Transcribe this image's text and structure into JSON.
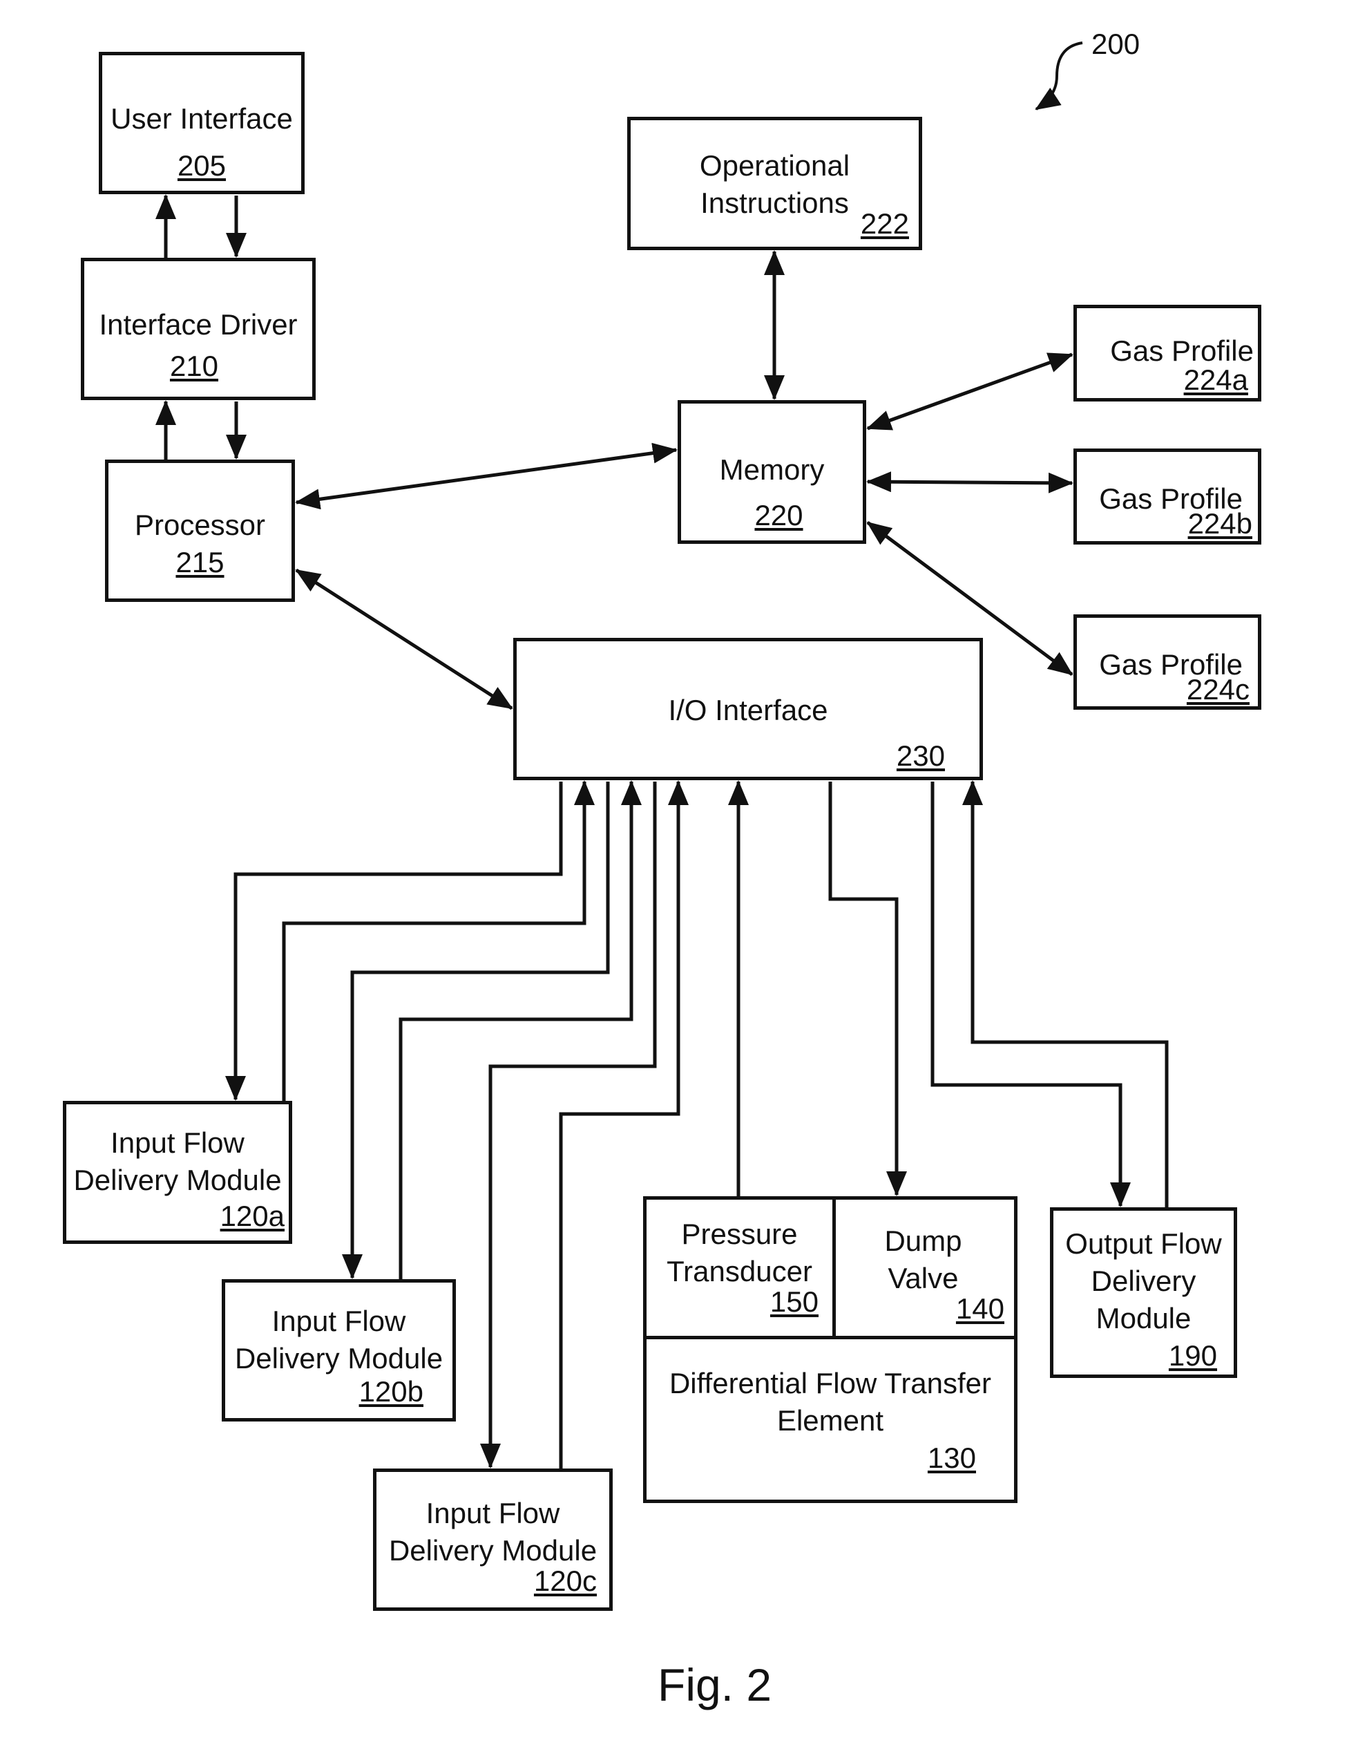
{
  "figure": {
    "label": "Fig. 2",
    "ref": "200"
  },
  "blocks": {
    "user_interface": {
      "name": "User Interface",
      "ref": "205"
    },
    "interface_driver": {
      "name": "Interface Driver",
      "ref": "210"
    },
    "processor": {
      "name": "Processor",
      "ref": "215"
    },
    "operational_instructions": {
      "line1": "Operational",
      "line2": "Instructions",
      "ref": "222"
    },
    "memory": {
      "name": "Memory",
      "ref": "220"
    },
    "gas_profile_a": {
      "name": "Gas Profile",
      "ref": "224a"
    },
    "gas_profile_b": {
      "name": "Gas Profile",
      "ref": "224b"
    },
    "gas_profile_c": {
      "name": "Gas Profile",
      "ref": "224c"
    },
    "io_interface": {
      "name": "I/O Interface",
      "ref": "230"
    },
    "input_flow_a": {
      "line1": "Input Flow",
      "line2": "Delivery Module",
      "ref": "120a"
    },
    "input_flow_b": {
      "line1": "Input Flow",
      "line2": "Delivery Module",
      "ref": "120b"
    },
    "input_flow_c": {
      "line1": "Input Flow",
      "line2": "Delivery Module",
      "ref": "120c"
    },
    "pressure_transducer": {
      "line1": "Pressure",
      "line2": "Transducer",
      "ref": "150"
    },
    "dump_valve": {
      "line1": "Dump",
      "line2": "Valve",
      "ref": "140"
    },
    "differential_flow": {
      "line1": "Differential Flow Transfer",
      "line2": "Element",
      "ref": "130"
    },
    "output_flow": {
      "line1": "Output Flow",
      "line2": "Delivery",
      "line3": "Module",
      "ref": "190"
    }
  },
  "connections": [
    {
      "from": "interface_driver",
      "to": "user_interface",
      "direction": "up"
    },
    {
      "from": "user_interface",
      "to": "interface_driver",
      "direction": "down"
    },
    {
      "from": "processor",
      "to": "interface_driver",
      "direction": "up"
    },
    {
      "from": "interface_driver",
      "to": "processor",
      "direction": "down"
    },
    {
      "from": "processor",
      "to": "memory",
      "direction": "bidirectional"
    },
    {
      "from": "processor",
      "to": "io_interface",
      "direction": "bidirectional"
    },
    {
      "from": "memory",
      "to": "operational_instructions",
      "direction": "bidirectional"
    },
    {
      "from": "memory",
      "to": "gas_profile_a",
      "direction": "bidirectional"
    },
    {
      "from": "memory",
      "to": "gas_profile_b",
      "direction": "bidirectional"
    },
    {
      "from": "memory",
      "to": "gas_profile_c",
      "direction": "bidirectional"
    },
    {
      "from": "io_interface",
      "to": "input_flow_a",
      "direction": "out"
    },
    {
      "from": "input_flow_a",
      "to": "io_interface",
      "direction": "in"
    },
    {
      "from": "io_interface",
      "to": "input_flow_b",
      "direction": "out"
    },
    {
      "from": "input_flow_b",
      "to": "io_interface",
      "direction": "in"
    },
    {
      "from": "io_interface",
      "to": "input_flow_c",
      "direction": "out"
    },
    {
      "from": "input_flow_c",
      "to": "io_interface",
      "direction": "in"
    },
    {
      "from": "pressure_transducer",
      "to": "io_interface",
      "direction": "in"
    },
    {
      "from": "io_interface",
      "to": "dump_valve",
      "direction": "out"
    },
    {
      "from": "io_interface",
      "to": "output_flow",
      "direction": "out"
    },
    {
      "from": "output_flow",
      "to": "io_interface",
      "direction": "in"
    }
  ]
}
